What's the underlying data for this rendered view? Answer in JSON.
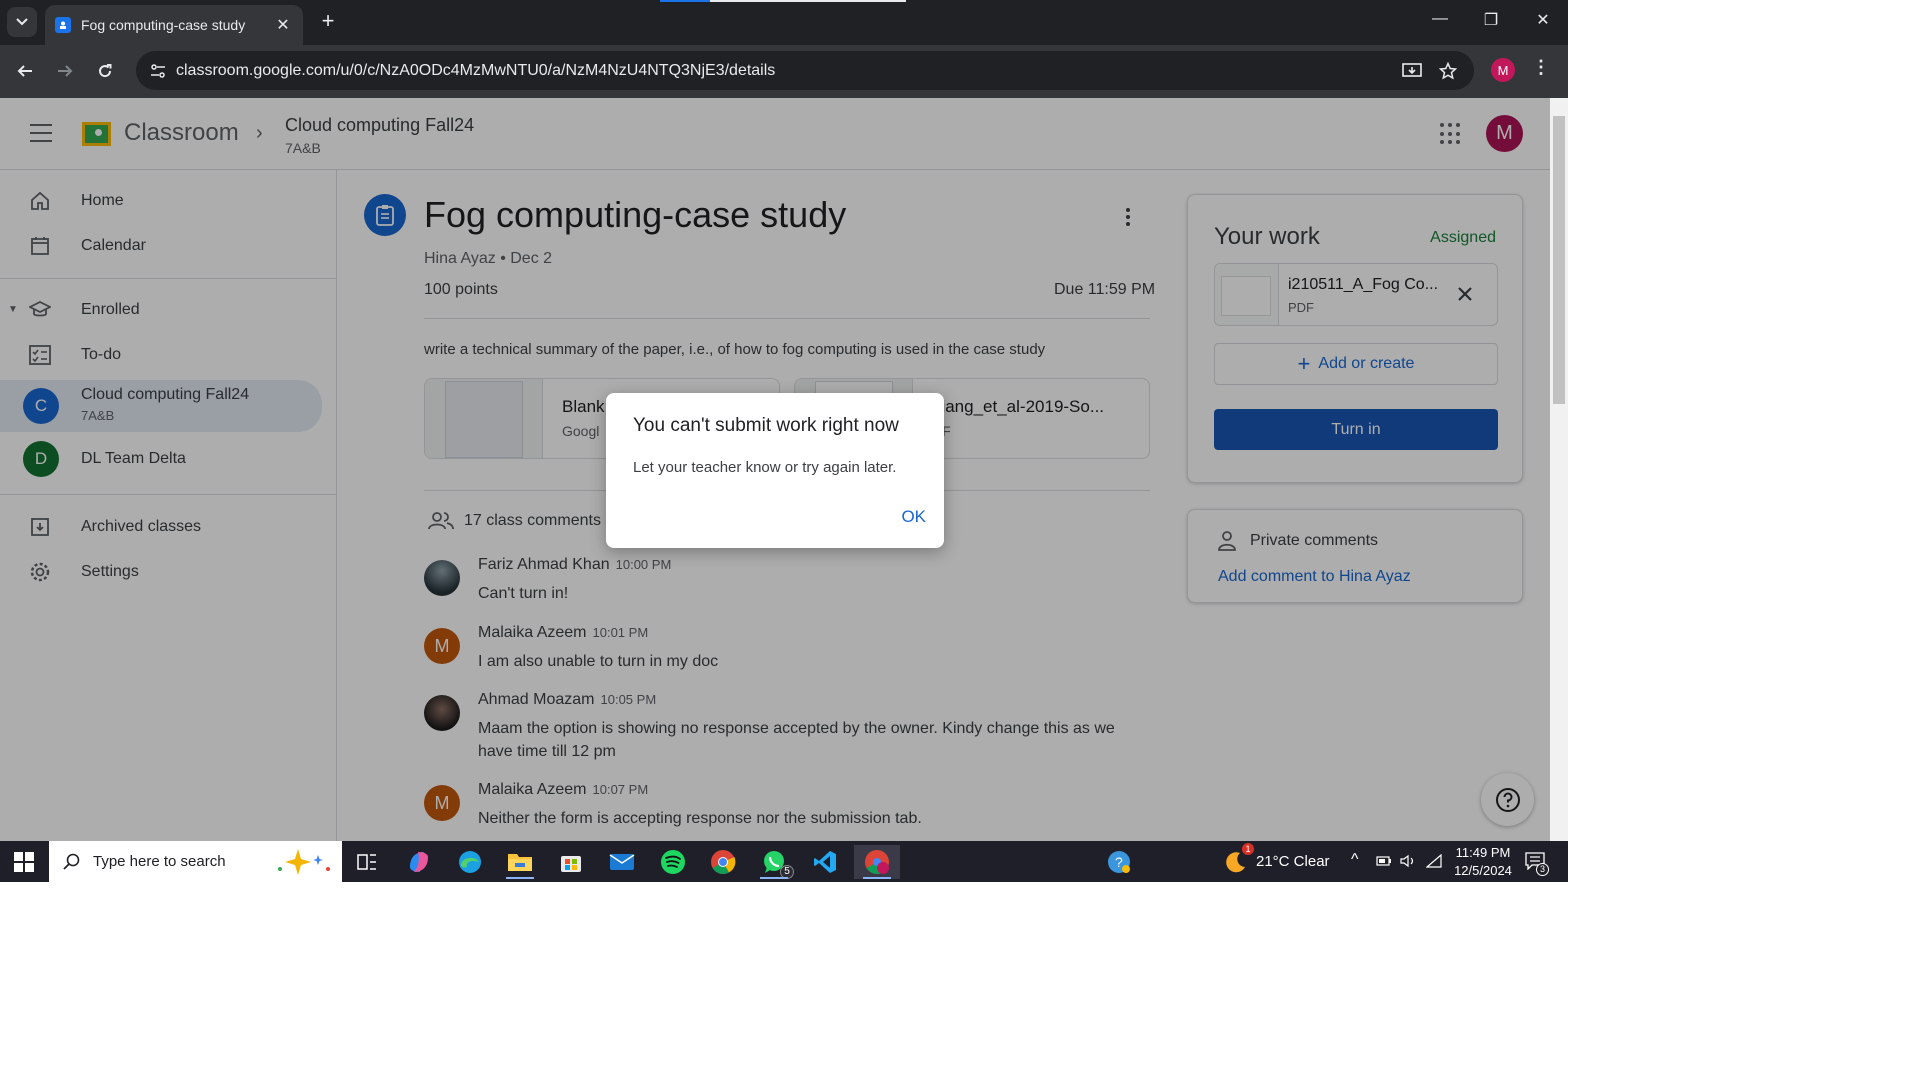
{
  "browser": {
    "tab_title": "Fog computing-case study",
    "tab_close": "✕",
    "new_tab": "+",
    "url": "classroom.google.com/u/0/c/NzA0ODc4MzMwNTU0/a/NzM4NzU4NTQ3NjE3/details",
    "profile_initial": "M",
    "window_controls": {
      "minimize": "—",
      "restore": "❐",
      "close": "✕"
    }
  },
  "header": {
    "brand": "Classroom",
    "course_name": "Cloud computing Fall24",
    "course_section": "7A&B",
    "avatar_initial": "M"
  },
  "sidebar": {
    "items": [
      {
        "label": "Home",
        "icon": "home-icon"
      },
      {
        "label": "Calendar",
        "icon": "calendar-icon"
      },
      {
        "label": "Enrolled",
        "icon": "enrolled-icon"
      },
      {
        "label": "To-do",
        "icon": "todo-icon"
      },
      {
        "label": "Archived classes",
        "icon": "archive-icon"
      },
      {
        "label": "Settings",
        "icon": "gear-icon"
      }
    ],
    "courses": [
      {
        "initial": "C",
        "name": "Cloud computing Fall24",
        "section": "7A&B",
        "color": "#1967d2",
        "selected": true
      },
      {
        "initial": "D",
        "name": "DL Team Delta",
        "section": "",
        "color": "#137333",
        "selected": false
      }
    ]
  },
  "assignment": {
    "title": "Fog computing-case study",
    "meta": "Hina Ayaz • Dec 2",
    "points": "100 points",
    "due": "Due 11:59 PM",
    "description": "write a technical summary of the paper, i.e., of how to fog computing is used in the case study",
    "attachments": [
      {
        "name": "Blank",
        "type": "Googl"
      },
      {
        "name": "giang_et_al-2019-So...",
        "type": "DF"
      }
    ],
    "comments_count": "17 class comments"
  },
  "comments": [
    {
      "author": "Fariz Ahmad Khan",
      "time": "10:00 PM",
      "text": "Can't turn in!",
      "avatar": "",
      "avatar_color": "#37474f"
    },
    {
      "author": "Malaika Azeem",
      "time": "10:01 PM",
      "text": "I am also unable to turn in my doc",
      "avatar": "M",
      "avatar_color": "#c1570b"
    },
    {
      "author": "Ahmad Moazam",
      "time": "10:05 PM",
      "text": "Maam the option is showing no response accepted by the owner. Kindy change this as we have time till 12 pm",
      "avatar": "",
      "avatar_color": "#3e2723"
    },
    {
      "author": "Malaika Azeem",
      "time": "10:07 PM",
      "text": "Neither the form is accepting response nor the submission tab.",
      "avatar": "M",
      "avatar_color": "#c1570b"
    }
  ],
  "your_work": {
    "title": "Your work",
    "status": "Assigned",
    "file_name": "i210511_A_Fog Co...",
    "file_type": "PDF",
    "add_label": "Add or create",
    "add_plus": "+",
    "turn_in_label": "Turn in"
  },
  "private_comments": {
    "title": "Private comments",
    "link": "Add comment to Hina Ayaz"
  },
  "dialog": {
    "title": "You can't submit work right now",
    "body": "Let your teacher know or try again later.",
    "ok": "OK"
  },
  "taskbar": {
    "search_placeholder": "Type here to search",
    "whatsapp_badge": "5",
    "weather_badge": "1",
    "weather": "21°C  Clear",
    "time": "11:49 PM",
    "date": "12/5/2024",
    "notification_count": "3"
  },
  "colors": {
    "accent": "#1967d2",
    "turn_in": "#1a56b4",
    "assigned": "#188038"
  }
}
